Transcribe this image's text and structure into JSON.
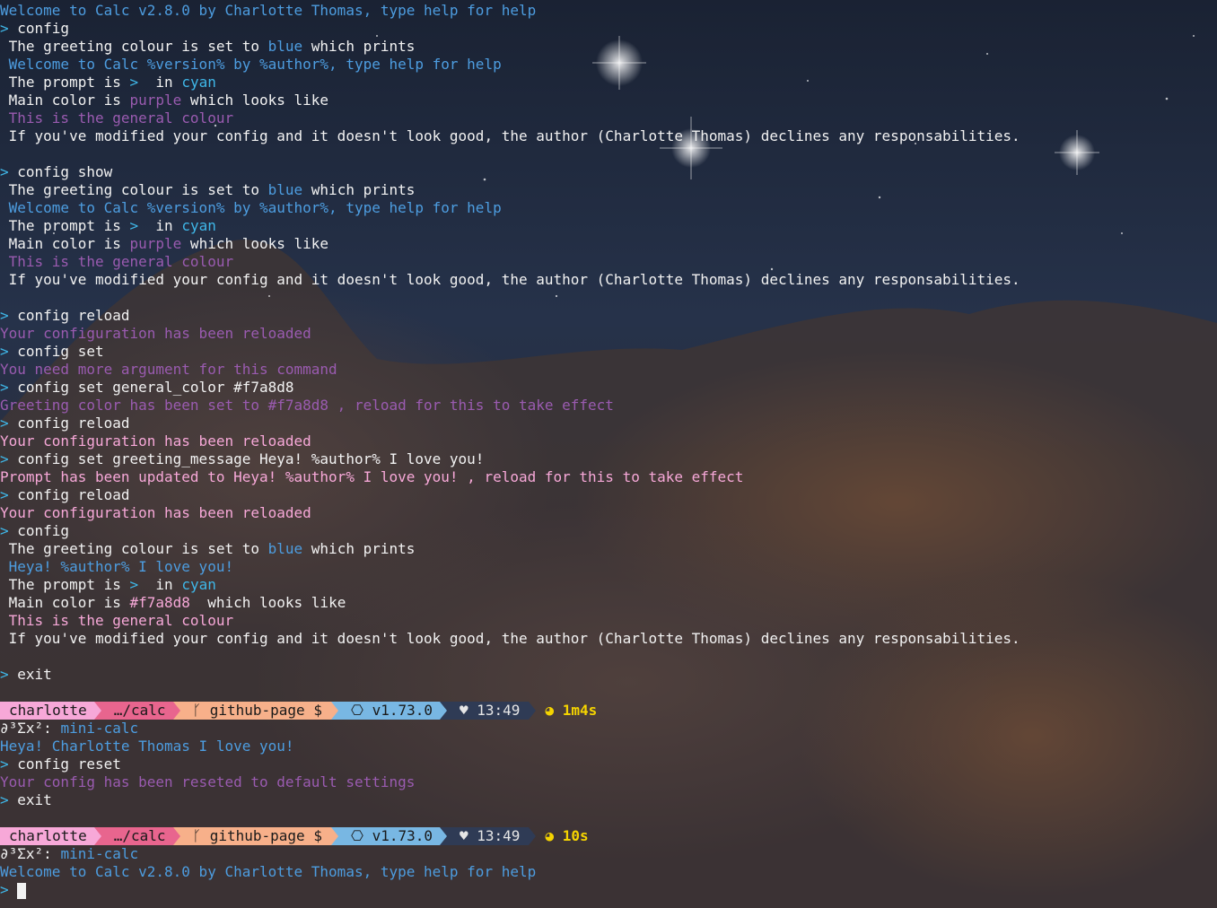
{
  "colors": {
    "blue": "#4d9de0",
    "cyan": "#3fb7e8",
    "purple": "#9a5bb0",
    "pink": "#f7a8d8",
    "white": "#f2f2f2",
    "prompt_user_bg": "#f7a8d8",
    "prompt_dir_bg": "#e8658e",
    "prompt_git_bg": "#f7b08a",
    "prompt_node_bg": "#78b7e3",
    "prompt_time_bg": "#2f3b55",
    "duration": "#f5d400"
  },
  "prompt_char": ">",
  "lines": [
    {
      "segs": [
        {
          "t": "Welcome to Calc v2.8.0 by Charlotte Thomas, type help for help",
          "c": "blue"
        }
      ]
    },
    {
      "segs": [
        {
          "t": "> ",
          "c": "cyan"
        },
        {
          "t": "config",
          "c": "white"
        }
      ]
    },
    {
      "segs": [
        {
          "t": " The greeting colour is set to ",
          "c": "white"
        },
        {
          "t": "blue",
          "c": "blue"
        },
        {
          "t": " which prints",
          "c": "white"
        }
      ]
    },
    {
      "segs": [
        {
          "t": " Welcome to Calc %version% by %author%, type help for help",
          "c": "blue"
        }
      ]
    },
    {
      "segs": [
        {
          "t": " The prompt is ",
          "c": "white"
        },
        {
          "t": ">",
          "c": "cyan"
        },
        {
          "t": "  in ",
          "c": "white"
        },
        {
          "t": "cyan",
          "c": "cyan"
        }
      ]
    },
    {
      "segs": [
        {
          "t": " Main color is ",
          "c": "white"
        },
        {
          "t": "purple",
          "c": "purple"
        },
        {
          "t": " which looks like",
          "c": "white"
        }
      ]
    },
    {
      "segs": [
        {
          "t": " This is the general colour",
          "c": "purple"
        }
      ]
    },
    {
      "segs": [
        {
          "t": " If you've modified your config and it doesn't look good, the author (Charlotte Thomas) declines any responsabilities.",
          "c": "white"
        }
      ]
    },
    {
      "segs": [
        {
          "t": "",
          "c": "white"
        }
      ]
    },
    {
      "segs": [
        {
          "t": "> ",
          "c": "cyan"
        },
        {
          "t": "config show",
          "c": "white"
        }
      ]
    },
    {
      "segs": [
        {
          "t": " The greeting colour is set to ",
          "c": "white"
        },
        {
          "t": "blue",
          "c": "blue"
        },
        {
          "t": " which prints",
          "c": "white"
        }
      ]
    },
    {
      "segs": [
        {
          "t": " Welcome to Calc %version% by %author%, type help for help",
          "c": "blue"
        }
      ]
    },
    {
      "segs": [
        {
          "t": " The prompt is ",
          "c": "white"
        },
        {
          "t": ">",
          "c": "cyan"
        },
        {
          "t": "  in ",
          "c": "white"
        },
        {
          "t": "cyan",
          "c": "cyan"
        }
      ]
    },
    {
      "segs": [
        {
          "t": " Main color is ",
          "c": "white"
        },
        {
          "t": "purple",
          "c": "purple"
        },
        {
          "t": " which looks like",
          "c": "white"
        }
      ]
    },
    {
      "segs": [
        {
          "t": " This is the general colour",
          "c": "purple"
        }
      ]
    },
    {
      "segs": [
        {
          "t": " If you've modified your config and it doesn't look good, the author (Charlotte Thomas) declines any responsabilities.",
          "c": "white"
        }
      ]
    },
    {
      "segs": [
        {
          "t": "",
          "c": "white"
        }
      ]
    },
    {
      "segs": [
        {
          "t": "> ",
          "c": "cyan"
        },
        {
          "t": "config reload",
          "c": "white"
        }
      ]
    },
    {
      "segs": [
        {
          "t": "Your configuration has been reloaded",
          "c": "purple"
        }
      ]
    },
    {
      "segs": [
        {
          "t": "> ",
          "c": "cyan"
        },
        {
          "t": "config set",
          "c": "white"
        }
      ]
    },
    {
      "segs": [
        {
          "t": "You need more argument for this command",
          "c": "purple"
        }
      ]
    },
    {
      "segs": [
        {
          "t": "> ",
          "c": "cyan"
        },
        {
          "t": "config set general_color #f7a8d8",
          "c": "white"
        }
      ]
    },
    {
      "segs": [
        {
          "t": "Greeting color has been set to #f7a8d8 , reload for this to take effect",
          "c": "purple"
        }
      ]
    },
    {
      "segs": [
        {
          "t": "> ",
          "c": "cyan"
        },
        {
          "t": "config reload",
          "c": "white"
        }
      ]
    },
    {
      "segs": [
        {
          "t": "Your configuration has been reloaded",
          "c": "pink"
        }
      ]
    },
    {
      "segs": [
        {
          "t": "> ",
          "c": "cyan"
        },
        {
          "t": "config set greeting_message Heya! %author% I love you!",
          "c": "white"
        }
      ]
    },
    {
      "segs": [
        {
          "t": "Prompt has been updated to Heya! %author% I love you! , reload for this to take effect",
          "c": "pink"
        }
      ]
    },
    {
      "segs": [
        {
          "t": "> ",
          "c": "cyan"
        },
        {
          "t": "config reload",
          "c": "white"
        }
      ]
    },
    {
      "segs": [
        {
          "t": "Your configuration has been reloaded",
          "c": "pink"
        }
      ]
    },
    {
      "segs": [
        {
          "t": "> ",
          "c": "cyan"
        },
        {
          "t": "config",
          "c": "white"
        }
      ]
    },
    {
      "segs": [
        {
          "t": " The greeting colour is set to ",
          "c": "white"
        },
        {
          "t": "blue",
          "c": "blue"
        },
        {
          "t": " which prints",
          "c": "white"
        }
      ]
    },
    {
      "segs": [
        {
          "t": " Heya! %author% I love you!",
          "c": "blue"
        }
      ]
    },
    {
      "segs": [
        {
          "t": " The prompt is ",
          "c": "white"
        },
        {
          "t": ">",
          "c": "cyan"
        },
        {
          "t": "  in ",
          "c": "white"
        },
        {
          "t": "cyan",
          "c": "cyan"
        }
      ]
    },
    {
      "segs": [
        {
          "t": " Main color is ",
          "c": "white"
        },
        {
          "t": "#f7a8d8",
          "c": "pink"
        },
        {
          "t": "  which looks like",
          "c": "white"
        }
      ]
    },
    {
      "segs": [
        {
          "t": " This is the general colour",
          "c": "pink"
        }
      ]
    },
    {
      "segs": [
        {
          "t": " If you've modified your config and it doesn't look good, the author (Charlotte Thomas) declines any responsabilities.",
          "c": "white"
        }
      ]
    },
    {
      "segs": [
        {
          "t": "",
          "c": "white"
        }
      ]
    },
    {
      "segs": [
        {
          "t": "> ",
          "c": "cyan"
        },
        {
          "t": "exit",
          "c": "white"
        }
      ]
    },
    {
      "segs": [
        {
          "t": "",
          "c": "white"
        }
      ]
    },
    {
      "prompt": {
        "user": "charlotte",
        "dir": "…/calc",
        "git": "ᚴ github-page $",
        "node": "⎔ v1.73.0",
        "time": "♥ 13:49",
        "duration": "◕ 1m4s"
      }
    },
    {
      "segs": [
        {
          "t": "∂³Σx²: ",
          "c": "white"
        },
        {
          "t": "mini-calc",
          "c": "blue"
        }
      ]
    },
    {
      "segs": [
        {
          "t": "Heya! Charlotte Thomas I love you!",
          "c": "blue"
        }
      ]
    },
    {
      "segs": [
        {
          "t": "> ",
          "c": "cyan"
        },
        {
          "t": "config reset",
          "c": "white"
        }
      ]
    },
    {
      "segs": [
        {
          "t": "Your config has been reseted to default settings",
          "c": "purple"
        }
      ]
    },
    {
      "segs": [
        {
          "t": "> ",
          "c": "cyan"
        },
        {
          "t": "exit",
          "c": "white"
        }
      ]
    },
    {
      "segs": [
        {
          "t": "",
          "c": "white"
        }
      ]
    },
    {
      "prompt": {
        "user": "charlotte",
        "dir": "…/calc",
        "git": "ᚴ github-page $",
        "node": "⎔ v1.73.0",
        "time": "♥ 13:49",
        "duration": "◕ 10s"
      }
    },
    {
      "segs": [
        {
          "t": "∂³Σx²: ",
          "c": "white"
        },
        {
          "t": "mini-calc",
          "c": "blue"
        }
      ]
    },
    {
      "segs": [
        {
          "t": "Welcome to Calc v2.8.0 by Charlotte Thomas, type help for help",
          "c": "blue"
        }
      ]
    },
    {
      "input": true
    }
  ]
}
